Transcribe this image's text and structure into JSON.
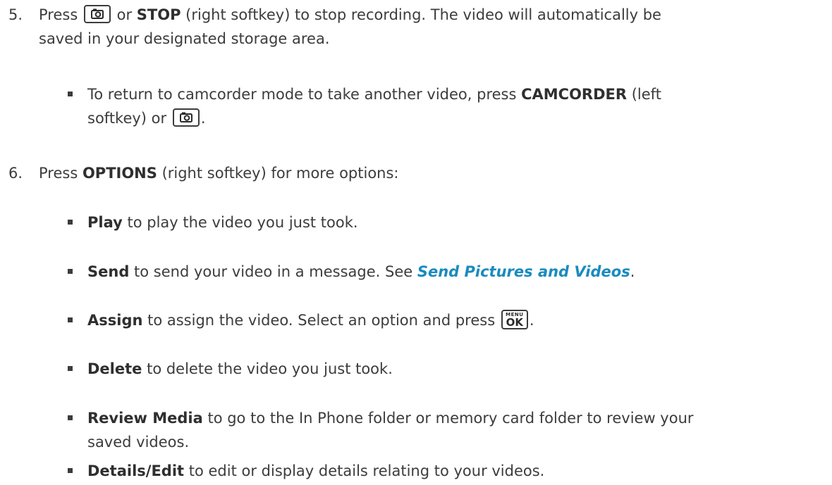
{
  "step5": {
    "number": "5.",
    "t1": "Press ",
    "t2": " or ",
    "stop": "STOP",
    "t3": " (right softkey) to stop recording. The video will automatically be",
    "line2": "saved in your designated storage area.",
    "key_icon": "camera-icon"
  },
  "step5_bullet": {
    "t1": "To return to camcorder mode to take another video, press ",
    "camcorder": "CAMCORDER",
    "t2": " (left",
    "t3": "softkey) or ",
    "t4": "."
  },
  "step6": {
    "number": "6.",
    "t1": "Press ",
    "options": "OPTIONS",
    "t2": " (right softkey) for more options:"
  },
  "options_list": {
    "play_bold": "Play",
    "play_text": " to play the video you just took.",
    "send_bold": "Send",
    "send_text": " to send your video in a message. See ",
    "send_link": "Send Pictures and Videos",
    "send_end": ".",
    "assign_bold": "Assign",
    "assign_text": " to assign the video. Select an option and press ",
    "assign_end": ".",
    "delete_bold": "Delete",
    "delete_text": " to delete the video you just took.",
    "review_bold": "Review Media",
    "review_text": " to go to the In Phone folder or memory card folder to review your",
    "review_line2": "saved videos.",
    "details_bold": "Details/Edit",
    "details_text": " to edit or display details relating to your videos."
  },
  "menu_ok_key": {
    "menu": "MENU",
    "ok": "OK"
  }
}
